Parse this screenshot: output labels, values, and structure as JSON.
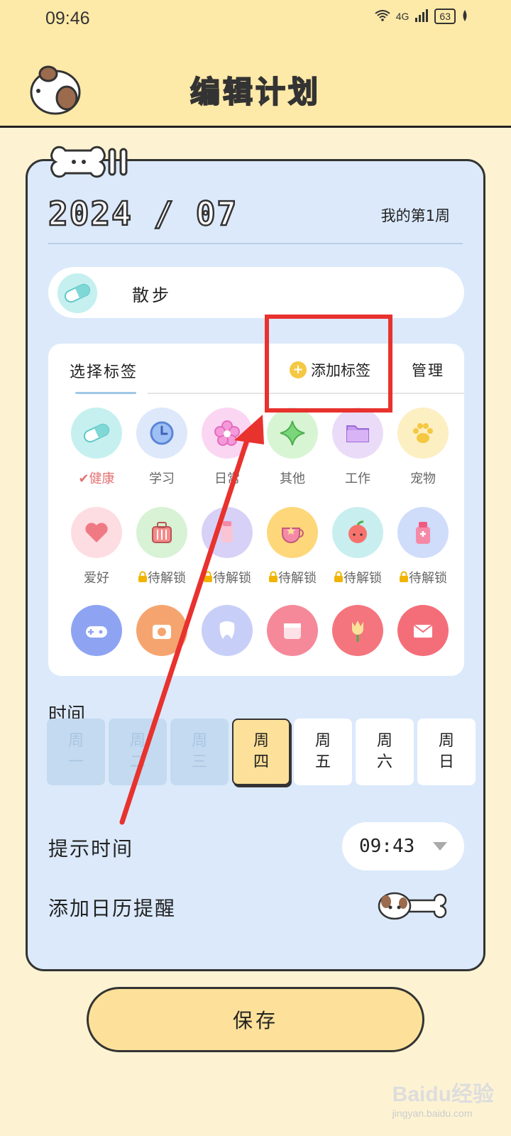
{
  "status_bar": {
    "time": "09:46",
    "network": "4G",
    "battery": "63"
  },
  "header": {
    "title": "编辑计划"
  },
  "card": {
    "month": "2024 / 07",
    "week_label": "我的第1周"
  },
  "plan": {
    "name": "散步",
    "icon": "capsule-icon"
  },
  "tags_panel": {
    "tab_select": "选择标签",
    "add_tag": "添加标签",
    "manage": "管理",
    "tags": [
      {
        "label": "健康",
        "icon": "capsule-icon",
        "color": "#c5f0ef",
        "selected": true
      },
      {
        "label": "学习",
        "icon": "clock-icon",
        "color": "#dde8fa"
      },
      {
        "label": "日常",
        "icon": "flower-icon",
        "color": "#fad6f2"
      },
      {
        "label": "其他",
        "icon": "sparkle-icon",
        "color": "#d7f5d3"
      },
      {
        "label": "工作",
        "icon": "folder-icon",
        "color": "#eadcf8"
      },
      {
        "label": "宠物",
        "icon": "paw-icon",
        "color": "#fcefc2"
      },
      {
        "label": "爱好",
        "icon": "heart-icon",
        "color": "#fddde2"
      },
      {
        "label": "待解锁",
        "icon": "suitcase-icon",
        "color": "#d7f2d4",
        "locked": true
      },
      {
        "label": "待解锁",
        "icon": "cup-icon",
        "color": "#d7d1f7",
        "locked": true
      },
      {
        "label": "待解锁",
        "icon": "teacup-icon",
        "color": "#fdd779",
        "locked": true
      },
      {
        "label": "待解锁",
        "icon": "apple-icon",
        "color": "#c8eef0",
        "locked": true
      },
      {
        "label": "待解锁",
        "icon": "bottle-icon",
        "color": "#cfdcfa",
        "locked": true
      },
      {
        "label": "",
        "icon": "gamepad-icon",
        "color": "#8ea4f2"
      },
      {
        "label": "",
        "icon": "camera-icon",
        "color": "#f6a46f"
      },
      {
        "label": "",
        "icon": "tooth-icon",
        "color": "#c7cff8"
      },
      {
        "label": "",
        "icon": "calendar-icon",
        "color": "#f5899a"
      },
      {
        "label": "",
        "icon": "tulip-icon",
        "color": "#f4757d"
      },
      {
        "label": "",
        "icon": "letter-icon",
        "color": "#f46e79"
      }
    ]
  },
  "time_section": {
    "label": "时间",
    "days": [
      {
        "top": "周",
        "bottom": "一",
        "state": "disabled"
      },
      {
        "top": "周",
        "bottom": "二",
        "state": "disabled"
      },
      {
        "top": "周",
        "bottom": "三",
        "state": "disabled"
      },
      {
        "top": "周",
        "bottom": "四",
        "state": "selected"
      },
      {
        "top": "周",
        "bottom": "五",
        "state": "normal"
      },
      {
        "top": "周",
        "bottom": "六",
        "state": "normal"
      },
      {
        "top": "周",
        "bottom": "日",
        "state": "normal"
      }
    ]
  },
  "reminder": {
    "label": "提示时间",
    "time": "09:43"
  },
  "calendar_reminder": {
    "label": "添加日历提醒",
    "enabled": false
  },
  "save_button": {
    "label": "保存"
  },
  "annotation": {
    "color": "#e8322e"
  },
  "watermark": {
    "text": "Baidu经验",
    "sub": "jingyan.baidu.com"
  }
}
